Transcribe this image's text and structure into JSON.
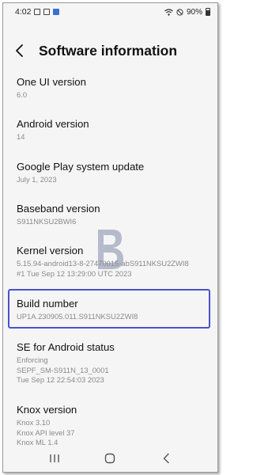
{
  "status_bar": {
    "time": "4:02",
    "battery": "90%",
    "icons": [
      "image-icon",
      "app-icon",
      "app-icon-filled",
      "wifi-icon",
      "mute-icon",
      "battery-icon"
    ]
  },
  "header": {
    "back_icon": "chevron-left-icon",
    "title": "Software information"
  },
  "items": [
    {
      "title": "One UI version",
      "lines": [
        "6.0"
      ]
    },
    {
      "title": "Android version",
      "lines": [
        "14"
      ]
    },
    {
      "title": "Google Play system update",
      "lines": [
        "July 1, 2023"
      ]
    },
    {
      "title": "Baseband version",
      "lines": [
        "S911NKSU2BWI6"
      ]
    },
    {
      "title": "Kernel version",
      "lines": [
        "5.15.94-android13-8-27470015-abS911NKSU2ZWI8",
        "#1 Tue Sep 12 13:29:00 UTC 2023"
      ]
    },
    {
      "title": "Build number",
      "lines": [
        "UP1A.230905.011.S911NKSU2ZWI8"
      ]
    },
    {
      "title": "SE for Android status",
      "lines": [
        "Enforcing",
        "SEPF_SM-S911N_13_0001",
        "Tue Sep 12 22:54:03 2023"
      ]
    },
    {
      "title": "Knox version",
      "lines": [
        "Knox 3.10",
        "Knox API level 37",
        "Knox ML 1.4"
      ]
    }
  ],
  "nav_bar": {
    "icons": [
      "recents-icon",
      "home-icon",
      "back-icon"
    ]
  },
  "colors": {
    "highlight": "#4a52c8",
    "background": "#f5f5f5",
    "subtext": "#8a8a8a"
  }
}
